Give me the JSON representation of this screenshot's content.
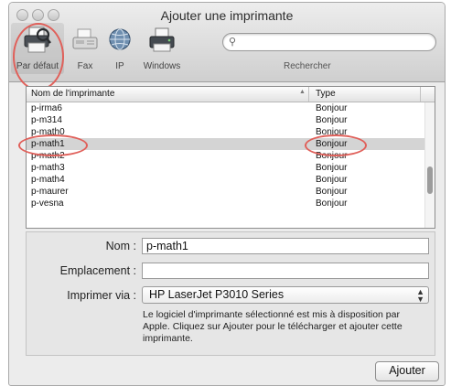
{
  "window": {
    "title": "Ajouter une imprimante"
  },
  "toolbar": {
    "items": [
      {
        "label": "Par défaut",
        "icon": "printer-magnifier-icon"
      },
      {
        "label": "Fax",
        "icon": "fax-icon"
      },
      {
        "label": "IP",
        "icon": "globe-icon"
      },
      {
        "label": "Windows",
        "icon": "windows-printer-icon"
      }
    ],
    "search_placeholder": "",
    "search_label": "Rechercher"
  },
  "list": {
    "columns": {
      "name": "Nom de l'imprimante",
      "type": "Type"
    },
    "rows": [
      {
        "name": "p-irma6",
        "type": "Bonjour"
      },
      {
        "name": "p-m314",
        "type": "Bonjour"
      },
      {
        "name": "p-math0",
        "type": "Bonjour"
      },
      {
        "name": "p-math1",
        "type": "Bonjour"
      },
      {
        "name": "p-math2",
        "type": "Bonjour"
      },
      {
        "name": "p-math3",
        "type": "Bonjour"
      },
      {
        "name": "p-math4",
        "type": "Bonjour"
      },
      {
        "name": "p-maurer",
        "type": "Bonjour"
      },
      {
        "name": "p-vesna",
        "type": "Bonjour"
      }
    ],
    "selected_row": "p-math1"
  },
  "form": {
    "name_label": "Nom :",
    "name_value": "p-math1",
    "location_label": "Emplacement :",
    "location_value": "",
    "use_label": "Imprimer via :",
    "use_value": "HP LaserJet P3010 Series",
    "note": "Le logiciel d'imprimante sélectionné est mis à disposition par Apple. Cliquez sur Ajouter pour le télécharger et ajouter cette imprimante."
  },
  "actions": {
    "add_label": "Ajouter"
  },
  "colors": {
    "highlight": "#e0605a",
    "selection": "#d4d4d4"
  }
}
